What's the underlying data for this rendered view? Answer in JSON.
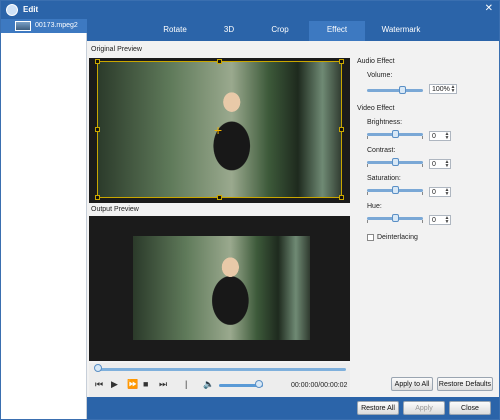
{
  "window": {
    "title": "Edit"
  },
  "sidebar": {
    "file_name": "00173.mpeg2"
  },
  "tabs": [
    {
      "label": "Rotate"
    },
    {
      "label": "3D"
    },
    {
      "label": "Crop"
    },
    {
      "label": "Effect",
      "active": true
    },
    {
      "label": "Watermark"
    }
  ],
  "preview": {
    "original_label": "Original Preview",
    "output_label": "Output Preview"
  },
  "player": {
    "time": "00:00:00/00:00:02",
    "volume_level": 0.85
  },
  "effects": {
    "audio_title": "Audio Effect",
    "volume_label": "Volume:",
    "volume_value": "100%",
    "video_title": "Video Effect",
    "brightness_label": "Brightness:",
    "brightness_value": "0",
    "contrast_label": "Contrast:",
    "contrast_value": "0",
    "saturation_label": "Saturation:",
    "saturation_value": "0",
    "hue_label": "Hue:",
    "hue_value": "0",
    "deinterlacing_label": "Deinterlacing",
    "deinterlacing_checked": false
  },
  "buttons": {
    "apply_to_all": "Apply to All",
    "restore_defaults": "Restore Defaults",
    "restore_all": "Restore All",
    "apply": "Apply",
    "close": "Close"
  },
  "colors": {
    "titlebar": "#2b64a9",
    "accent": "#3d79c1",
    "crop_frame": "#c9a600"
  }
}
